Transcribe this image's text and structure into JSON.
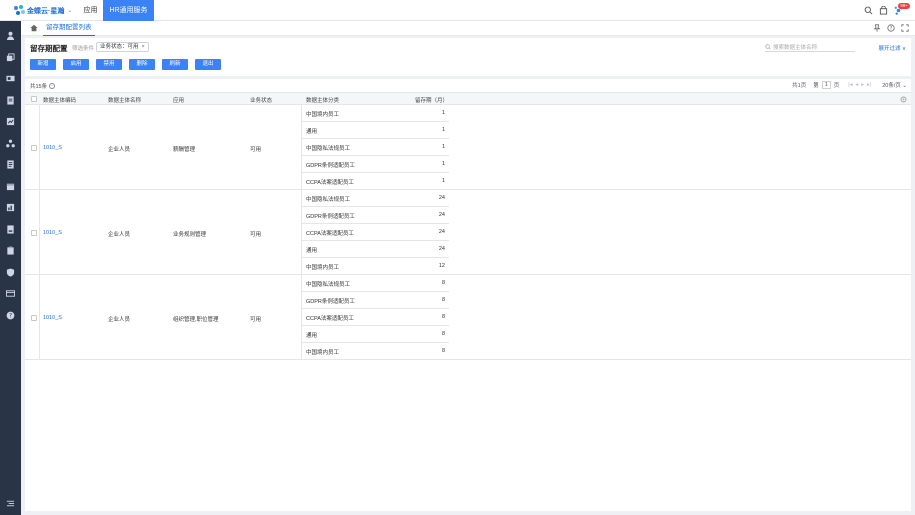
{
  "topbar": {
    "brand": "金蝶云·星瀚",
    "nav_app": "应用",
    "nav_active": "HR通用服务",
    "badge": "99+"
  },
  "tabs": {
    "active": "留存期配置列表"
  },
  "header": {
    "title": "留存期配置",
    "filter_label": "筛选条件",
    "filter_chip": "业务状态：可用",
    "search_placeholder": "搜索数据主体名称",
    "expand_filter": "展开过滤 ∨",
    "buttons": [
      "新增",
      "启用",
      "禁用",
      "删除",
      "刷新",
      "退出"
    ]
  },
  "table": {
    "count": "共15条",
    "pager": {
      "total_pages": "共1页",
      "page_label": "第",
      "page": "1",
      "page_unit": "页",
      "page_size": "20条/页"
    },
    "headers": [
      "数据主体编码",
      "数据主体名称",
      "应用",
      "业务状态",
      "数据主体分类",
      "留存期（月）"
    ],
    "groups": [
      {
        "code": "1010_S",
        "name": "企业人员",
        "app": "薪酬管理",
        "status": "可用",
        "rows": [
          {
            "category": "中国境内员工",
            "retention": "1"
          },
          {
            "category": "通用",
            "retention": "1"
          },
          {
            "category": "中国隐私法规员工",
            "retention": "1"
          },
          {
            "category": "GDPR条例适配员工",
            "retention": "1"
          },
          {
            "category": "CCPA法案适配员工",
            "retention": "1"
          }
        ]
      },
      {
        "code": "1010_S",
        "name": "企业人员",
        "app": "业务规则管理",
        "status": "可用",
        "rows": [
          {
            "category": "中国隐私法规员工",
            "retention": "24"
          },
          {
            "category": "GDPR条例适配员工",
            "retention": "24"
          },
          {
            "category": "CCPA法案适配员工",
            "retention": "24"
          },
          {
            "category": "通用",
            "retention": "24"
          },
          {
            "category": "中国境内员工",
            "retention": "12"
          }
        ]
      },
      {
        "code": "1010_S",
        "name": "企业人员",
        "app": "组织管理,职位管理",
        "status": "可用",
        "rows": [
          {
            "category": "中国隐私法规员工",
            "retention": "8"
          },
          {
            "category": "GDPR条例适配员工",
            "retention": "8"
          },
          {
            "category": "CCPA法案适配员工",
            "retention": "8"
          },
          {
            "category": "通用",
            "retention": "8"
          },
          {
            "category": "中国境内员工",
            "retention": "8"
          }
        ]
      }
    ]
  },
  "colors": {
    "accent": "#3b82f6",
    "link": "#1f6fd6",
    "sidebar": "#2a3447",
    "badge": "#f23a3a"
  }
}
